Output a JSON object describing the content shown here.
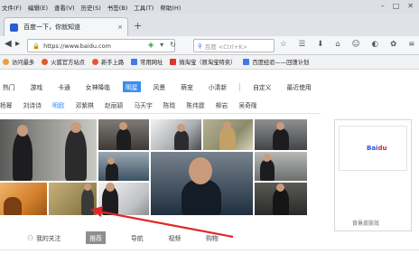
{
  "menu": [
    "文件(F)",
    "编辑(E)",
    "查看(V)",
    "历史(S)",
    "书签(B)",
    "工具(T)",
    "帮助(H)"
  ],
  "tab": {
    "title": "百度一下，你就知道",
    "close": "×",
    "new_tab": "+"
  },
  "navbar": {
    "url": "https://www.baidu.com",
    "search_placeholder": "百度 <Ctrl+K>"
  },
  "bookmarks": [
    {
      "label": "访问最多",
      "color": "#e8a13b"
    },
    {
      "label": "火狐官方站点",
      "color": "#e25a2c"
    },
    {
      "label": "新手上路",
      "color": "#e25a2c"
    },
    {
      "label": "常用网址",
      "color": "#3b7de8"
    },
    {
      "label": "微淘宝（原淘宝特卖）",
      "color": "#e2342c"
    },
    {
      "label": "百度经验——回馈计划",
      "color": "#3b7de8"
    }
  ],
  "categories": [
    "热门",
    "游戏",
    "卡通",
    "女神降临",
    "明星",
    "风景",
    "萌宠",
    "小清新"
  ],
  "categories_active": "明星",
  "categories_extra": [
    "自定义",
    "最近使用"
  ],
  "subcategories": [
    "杨幂",
    "刘诗诗",
    "明欧",
    "邓紫棋",
    "赵丽颖",
    "马天宇",
    "陈晓",
    "陈伟霆",
    "柳岩",
    "吴奇隆"
  ],
  "subcategories_active": "明欧",
  "ad_logo": "Bai",
  "ad_logo_red": "du",
  "ad_link": "背景皮肤效",
  "bottom_tabs": [
    "我的关注",
    "推荐",
    "导航",
    "视频",
    "购物"
  ],
  "bottom_active": "推荐",
  "colors": {
    "accent": "#3b8cf2",
    "arrow": "#e02626"
  }
}
